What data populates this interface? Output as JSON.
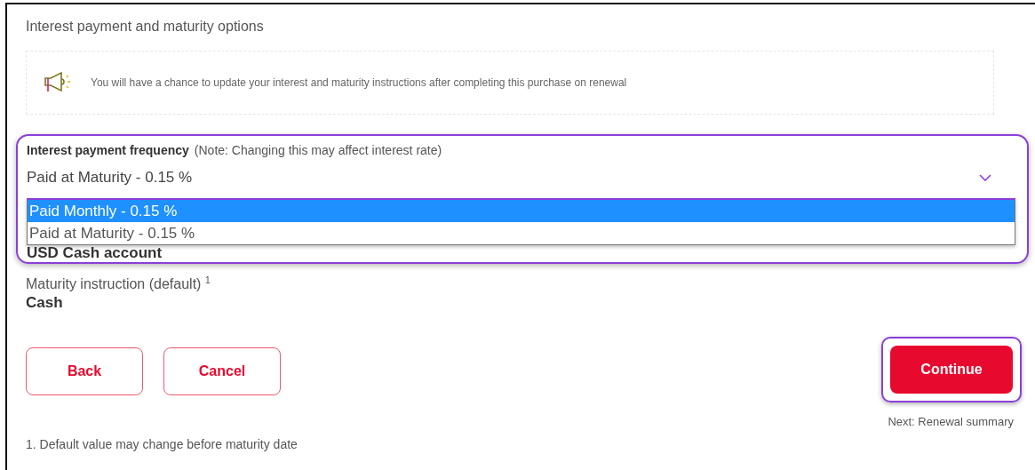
{
  "section_title": "Interest payment and maturity options",
  "notice": {
    "text": "You will have a chance to update your interest and maturity instructions after completing this purchase on renewal"
  },
  "frequency": {
    "label": "Interest payment frequency",
    "note": "(Note: Changing this may affect interest rate)",
    "value": "Paid at Maturity - 0.15 %",
    "expanded": true,
    "options": [
      {
        "label": "Paid Monthly - 0.15 %",
        "highlighted": true
      },
      {
        "label": "Paid at Maturity - 0.15 %",
        "highlighted": false
      }
    ]
  },
  "account_value": "USD Cash account",
  "maturity": {
    "label": "Maturity instruction (default)",
    "footnote_mark": "1",
    "value": "Cash"
  },
  "buttons": [
    {
      "label": "Back",
      "kind": "secondary"
    },
    {
      "label": "Cancel",
      "kind": "secondary"
    },
    {
      "label": "Continue",
      "kind": "primary"
    }
  ],
  "next_hint": "Next: Renewal summary",
  "footnote": "1. Default value may change before maturity date"
}
